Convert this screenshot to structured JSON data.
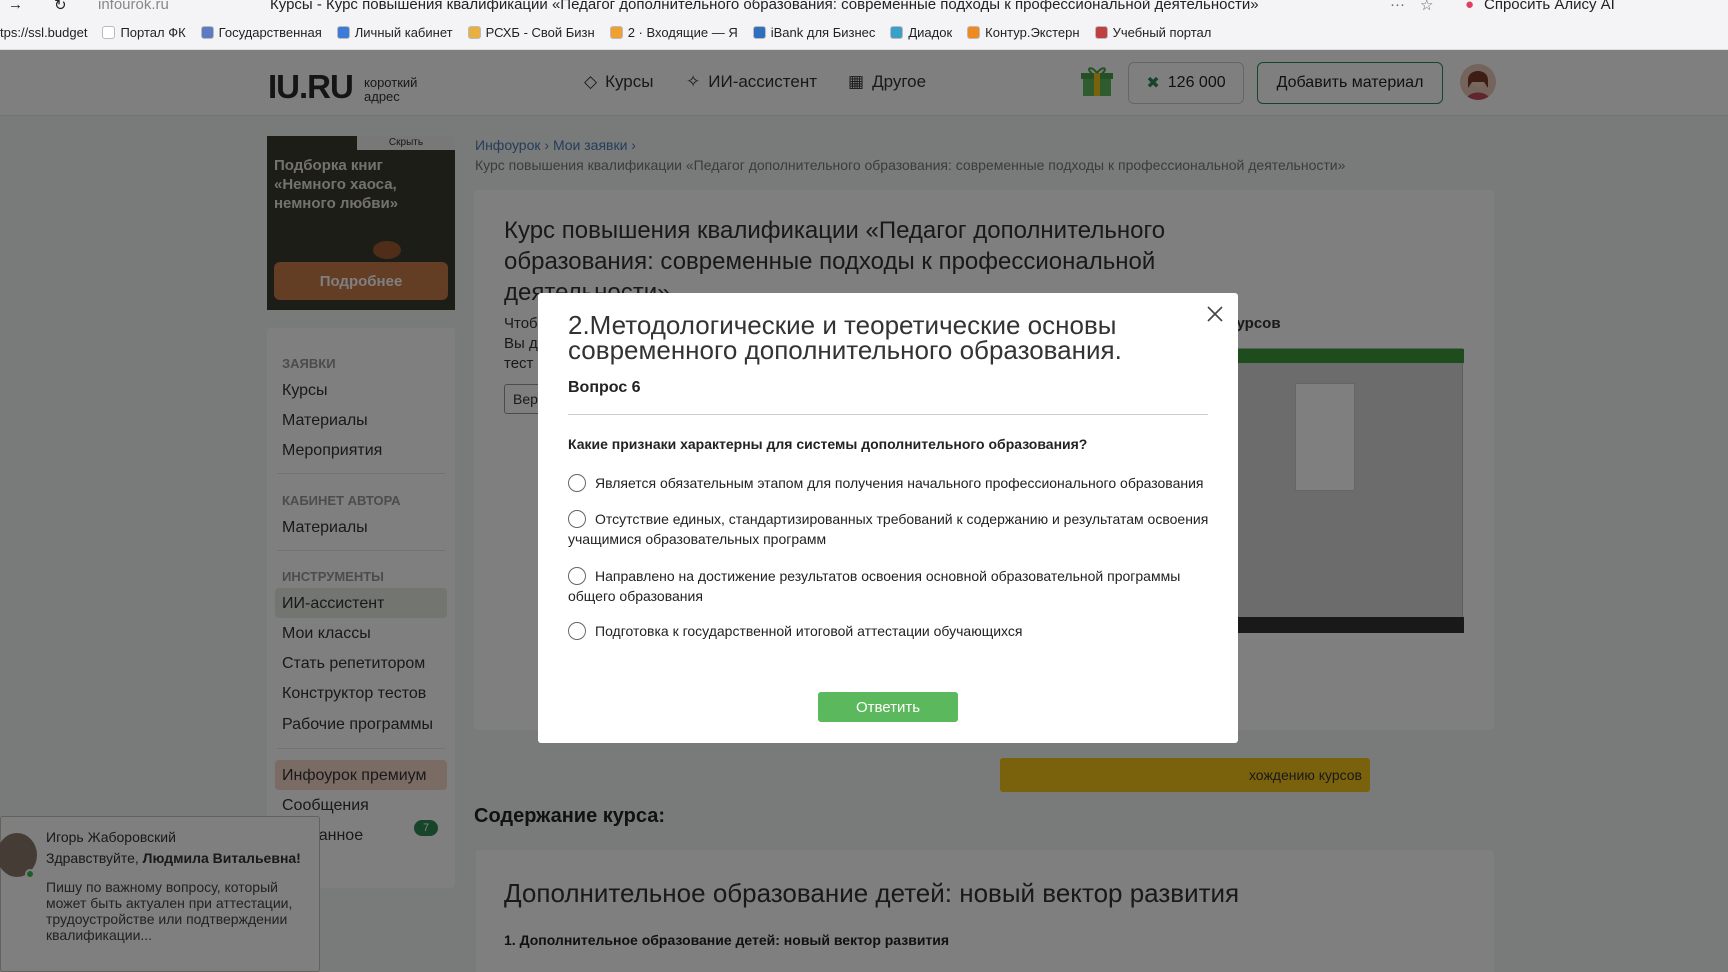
{
  "browser": {
    "url": "infourok.ru",
    "tab_title": "Курсы - Курс повышения квалификации «Педагог дополнительного образования: современные подходы к профессиональной деятельности»",
    "alice": "Спросить Алису AI",
    "bookmarks": [
      {
        "label": "tps://ssl.budget",
        "color": "#ffffff"
      },
      {
        "label": "Портал ФК",
        "color": "#ffffff"
      },
      {
        "label": "Государственная",
        "color": "#5b7cc4"
      },
      {
        "label": "Личный кабинет",
        "color": "#3b7bd9"
      },
      {
        "label": "РСХБ - Свой Бизн",
        "color": "#e8b040"
      },
      {
        "label": "2 · Входящие — Я",
        "color": "#f0a030"
      },
      {
        "label": "iBank для Бизнес",
        "color": "#2e6fc0"
      },
      {
        "label": "Диадок",
        "color": "#3aa0c8"
      },
      {
        "label": "Контур.Экстерн",
        "color": "#f08a1e"
      },
      {
        "label": "Учебный портал",
        "color": "#c04040"
      }
    ]
  },
  "header": {
    "logo": "IU.RU",
    "logo_sub": "короткий адрес",
    "nav": [
      {
        "label": "Курсы",
        "icon": "cap-icon"
      },
      {
        "label": "ИИ-ассистент",
        "icon": "sparkle-icon"
      },
      {
        "label": "Другое",
        "icon": "grid-icon"
      }
    ],
    "balance": "126 000",
    "add_material": "Добавить материал"
  },
  "ad": {
    "hide": "Скрыть",
    "title": "Подборка книг «Немного хаоса, немного любви»",
    "button": "Подробнее"
  },
  "sidebar": {
    "sections": [
      {
        "title": "ЗАЯВКИ",
        "items": [
          "Курсы",
          "Материалы",
          "Мероприятия"
        ]
      },
      {
        "title": "КАБИНЕТ АВТОРА",
        "items": [
          "Материалы"
        ]
      },
      {
        "title": "ИНСТРУМЕНТЫ",
        "items": [
          "ИИ-ассистент",
          "Мои классы",
          "Стать репетитором",
          "Конструктор тестов",
          "Рабочие программы"
        ]
      }
    ],
    "premium": "Инфоурок премиум",
    "messages": "Сообщения",
    "messages_count": "7",
    "favorites": "Избранное"
  },
  "breadcrumb": {
    "items": [
      "Инфоурок",
      "Мои заявки"
    ],
    "current": "Курс повышения квалификации «Педагог дополнительного образования: современные подходы к профессиональной деятельности»"
  },
  "course": {
    "title": "Курс повышения квалификации «Педагог дополнительного образования: современные подходы к профессиональной деятельности»",
    "text_lines": [
      "Чтоб",
      "Вы д",
      "тест"
    ],
    "button": "Вер",
    "right_label": "курсов",
    "instruction_button": "хождению курсов"
  },
  "content": {
    "heading": "Содержание курса:",
    "module_title": "Дополнительное образование детей: новый вектор развития",
    "module_sub": "1. Дополнительное образование детей: новый вектор развития"
  },
  "chat": {
    "name": "Игорь Жаборовский",
    "greeting": "Здравствуйте,",
    "addressee": "Людмила Витальевна!",
    "message": "Пишу по важному вопросу, который может быть актуален при аттестации, трудоустройстве или подтверждении квалификации..."
  },
  "modal": {
    "title": "2.Методологические и теоретические основы современного дополнительного образования.",
    "question_label": "Вопрос 6",
    "question_text": "Какие  признаки характерны для  системы дополнительного образования?",
    "options": [
      "Является обязательным этапом для получения начального профессионального образования",
      "Отсутствие единых, стандартизированных требований к содержанию и результатам освоения  учащимися образовательных программ",
      "Направлено на достижение результатов освоения основной образовательной программы общего образования",
      "Подготовка к  государственной итоговой аттестации обучающихся"
    ],
    "submit": "Ответить"
  }
}
